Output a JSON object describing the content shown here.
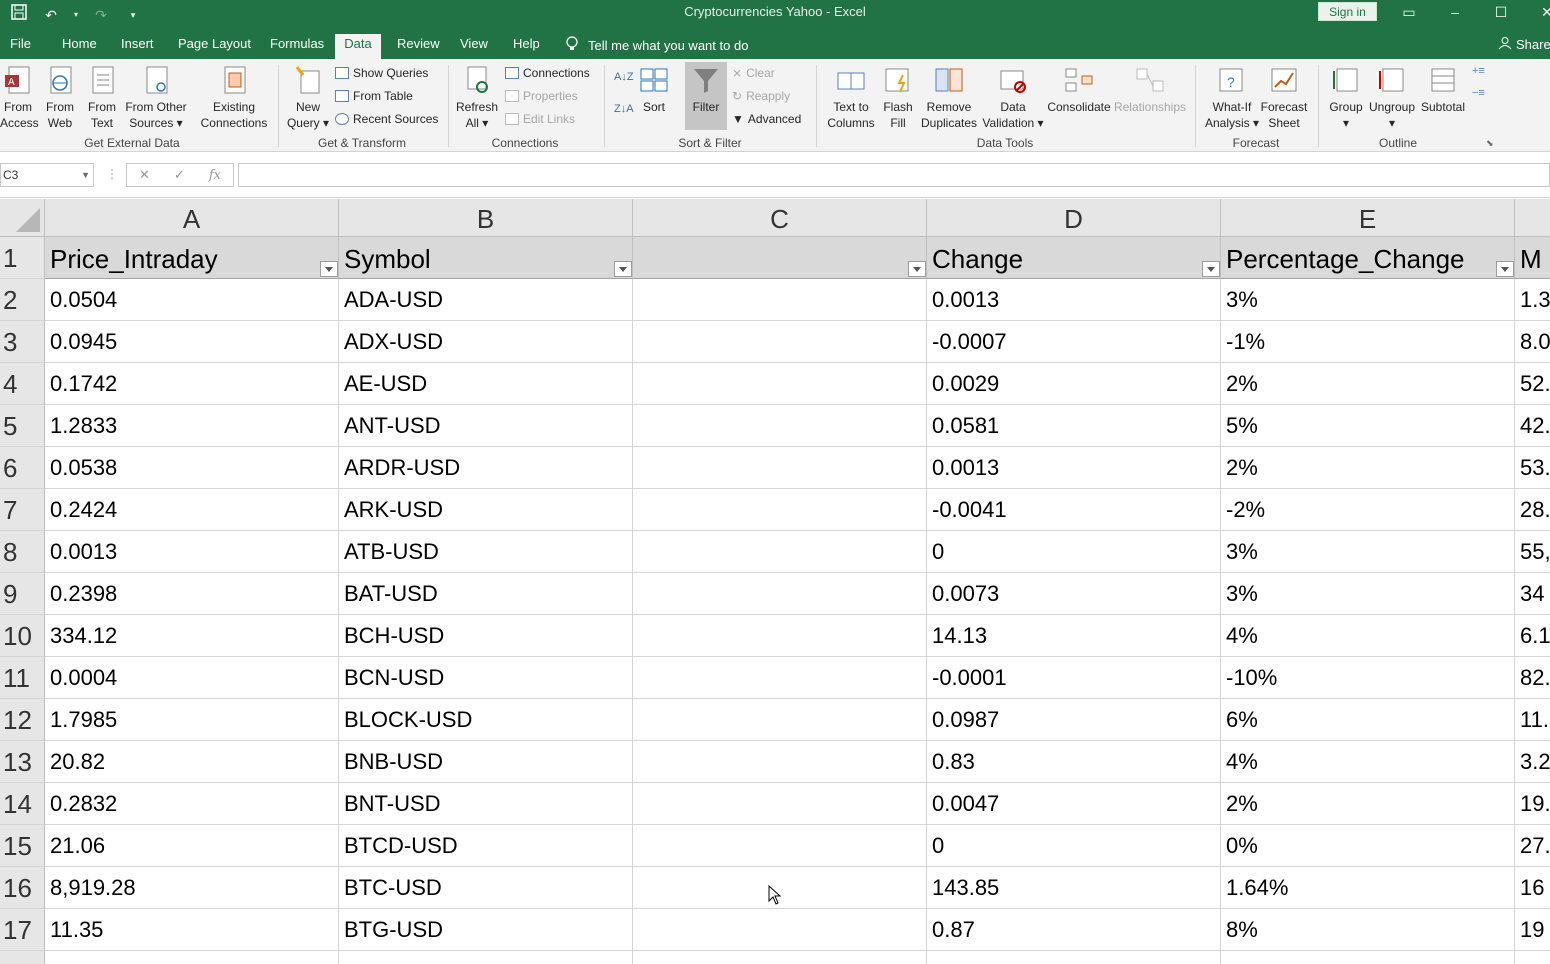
{
  "app": {
    "title": "Cryptocurrencies Yahoo  -  Excel",
    "sign_in": "Sign in"
  },
  "menu": {
    "tabs": [
      "File",
      "Home",
      "Insert",
      "Page Layout",
      "Formulas",
      "Data",
      "Review",
      "View",
      "Help"
    ],
    "active": "Data",
    "tell_me": "Tell me what you want to do",
    "share": "Share"
  },
  "ribbon": {
    "get_external": {
      "label": "Get External Data",
      "from_access": [
        "From",
        "Access"
      ],
      "from_web": [
        "From",
        "Web"
      ],
      "from_text": [
        "From",
        "Text"
      ],
      "from_other": [
        "From Other",
        "Sources ▾"
      ],
      "existing": [
        "Existing",
        "Connections"
      ]
    },
    "get_transform": {
      "label": "Get & Transform",
      "new_query": [
        "New",
        "Query ▾"
      ],
      "show_queries": "Show Queries",
      "from_table": "From Table",
      "recent_sources": "Recent Sources"
    },
    "connections": {
      "label": "Connections",
      "refresh_all": [
        "Refresh",
        "All ▾"
      ],
      "connections": "Connections",
      "properties": "Properties",
      "edit_links": "Edit Links"
    },
    "sort_filter": {
      "label": "Sort & Filter",
      "sort": "Sort",
      "filter": "Filter",
      "clear": "Clear",
      "reapply": "Reapply",
      "advanced": "Advanced"
    },
    "data_tools": {
      "label": "Data Tools",
      "text_to_columns": [
        "Text to",
        "Columns"
      ],
      "flash_fill": [
        "Flash",
        "Fill"
      ],
      "remove_duplicates": [
        "Remove",
        "Duplicates"
      ],
      "data_validation": [
        "Data",
        "Validation ▾"
      ],
      "consolidate": "Consolidate",
      "relationships": "Relationships"
    },
    "forecast": {
      "label": "Forecast",
      "what_if": [
        "What-If",
        "Analysis ▾"
      ],
      "forecast_sheet": [
        "Forecast",
        "Sheet"
      ]
    },
    "outline": {
      "label": "Outline",
      "group": "Group",
      "ungroup": "Ungroup",
      "subtotal": "Subtotal"
    }
  },
  "formula_bar": {
    "name_box": "C3",
    "value": ""
  },
  "sheet": {
    "columns": [
      "A",
      "B",
      "C",
      "D",
      "E"
    ],
    "headers": [
      "Price_Intraday",
      "Symbol",
      "",
      "Change",
      "Percentage_Change",
      "M"
    ],
    "rows": [
      {
        "n": "2",
        "a": "0.0504",
        "b": "ADA-USD",
        "c": "",
        "d": "0.0013",
        "e": "3%",
        "f": "1.3"
      },
      {
        "n": "3",
        "a": "0.0945",
        "b": "ADX-USD",
        "c": "",
        "d": "-0.0007",
        "e": "-1%",
        "f": "8.0"
      },
      {
        "n": "4",
        "a": "0.1742",
        "b": "AE-USD",
        "c": "",
        "d": "0.0029",
        "e": "2%",
        "f": "52."
      },
      {
        "n": "5",
        "a": "1.2833",
        "b": "ANT-USD",
        "c": "",
        "d": "0.0581",
        "e": "5%",
        "f": "42."
      },
      {
        "n": "6",
        "a": "0.0538",
        "b": "ARDR-USD",
        "c": "",
        "d": "0.0013",
        "e": "2%",
        "f": "53."
      },
      {
        "n": "7",
        "a": "0.2424",
        "b": "ARK-USD",
        "c": "",
        "d": "-0.0041",
        "e": "-2%",
        "f": "28."
      },
      {
        "n": "8",
        "a": "0.0013",
        "b": "ATB-USD",
        "c": "",
        "d": "0",
        "e": "3%",
        "f": "55,"
      },
      {
        "n": "9",
        "a": "0.2398",
        "b": "BAT-USD",
        "c": "",
        "d": "0.0073",
        "e": "3%",
        "f": "34"
      },
      {
        "n": "10",
        "a": "334.12",
        "b": "BCH-USD",
        "c": "",
        "d": "14.13",
        "e": "4%",
        "f": "6.1"
      },
      {
        "n": "11",
        "a": "0.0004",
        "b": "BCN-USD",
        "c": "",
        "d": "-0.0001",
        "e": "-10%",
        "f": "82."
      },
      {
        "n": "12",
        "a": "1.7985",
        "b": "BLOCK-USD",
        "c": "",
        "d": "0.0987",
        "e": "6%",
        "f": "11."
      },
      {
        "n": "13",
        "a": "20.82",
        "b": "BNB-USD",
        "c": "",
        "d": "0.83",
        "e": "4%",
        "f": "3.2"
      },
      {
        "n": "14",
        "a": "0.2832",
        "b": "BNT-USD",
        "c": "",
        "d": "0.0047",
        "e": "2%",
        "f": "19."
      },
      {
        "n": "15",
        "a": "21.06",
        "b": "BTCD-USD",
        "c": "",
        "d": "0",
        "e": "0%",
        "f": "27."
      },
      {
        "n": "16",
        "a": "8,919.28",
        "b": "BTC-USD",
        "c": "",
        "d": "143.85",
        "e": "1.64%",
        "f": "16"
      },
      {
        "n": "17",
        "a": "11.35",
        "b": "BTG-USD",
        "c": "",
        "d": "0.87",
        "e": "8%",
        "f": "19"
      }
    ]
  },
  "colors": {
    "excel_green": "#217346",
    "ribbon_bg": "#f3f3f3",
    "header_bg": "#d9d9d9"
  }
}
